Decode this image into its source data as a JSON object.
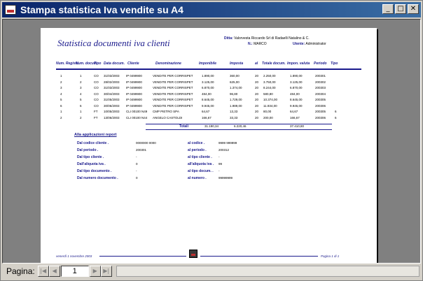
{
  "window": {
    "title": "Stampa statistica Iva vendite su A4",
    "minimize": "_",
    "maximize": "□",
    "close": "✕"
  },
  "report": {
    "title": "Statistica documenti iva clienti",
    "ditta_label": "Ditta:",
    "ditta_value": "Valorvesta Riccardo Srl di Radaelli Natalino & C.",
    "nr_label": "N.:",
    "nr_value": "MARCO",
    "utente_label": "Utente:",
    "utente_value": "Administrator",
    "columns": [
      "Num. Registr.",
      "Num. docum.",
      "Tipo",
      "Data docum.",
      "Cliente",
      "Denominazione",
      "Imponibile",
      "Imposta",
      "al",
      "Totale docum.",
      "Impon. valuta",
      "Periodo",
      "Tipo"
    ],
    "rows": [
      [
        "1",
        "1",
        "CO",
        "31/03/2003",
        "IP 0499900",
        "VENDITE PER CORRISPET",
        "1.890,00",
        "360,00",
        "20",
        "2.250,00",
        "1.890,00",
        "200301"
      ],
      [
        "2",
        "2",
        "CO",
        "28/02/2003",
        "IP 0499900",
        "VENDITE PER CORRISPET",
        "3.125,00",
        "625,00",
        "20",
        "3.750,00",
        "3.125,00",
        "200302"
      ],
      [
        "3",
        "3",
        "CO",
        "31/03/2003",
        "IP 0499900",
        "VENDITE PER CORRISPET",
        "6.870,00",
        "1.374,00",
        "20",
        "8.244,00",
        "6.870,00",
        "200303"
      ],
      [
        "4",
        "4",
        "CO",
        "30/04/2003",
        "IP 0499900",
        "VENDITE PER CORRISPET",
        "484,00",
        "96,80",
        "20",
        "580,80",
        "484,00",
        "200304"
      ],
      [
        "5",
        "5",
        "CO",
        "31/05/2003",
        "IP 0499900",
        "VENDITE PER CORRISPET",
        "8.645,00",
        "1.729,00",
        "20",
        "10.374,00",
        "8.645,00",
        "200305"
      ],
      [
        "6",
        "6",
        "CO",
        "30/06/2003",
        "IP 0499900",
        "VENDITE PER CORRISPET",
        "9.945,00",
        "1.989,00",
        "20",
        "11.934,00",
        "9.945,00",
        "200306"
      ],
      [
        "1",
        "1",
        "FT",
        "10/05/2003",
        "CLI 00100 N49",
        "CMP PIETRO SPA",
        "64,67",
        "13,33",
        "20",
        "80,00",
        "64,67",
        "200305"
      ],
      [
        "2",
        "2",
        "FT",
        "13/06/2003",
        "CLI 00100 N44",
        "ANGELO CASTOLDI",
        "166,67",
        "33,33",
        "20",
        "200,00",
        "166,67",
        "200306"
      ]
    ],
    "row_tipo_extra": [
      "",
      "",
      "",
      "",
      "",
      "",
      "6",
      "6"
    ],
    "total_label": "Totali",
    "totals": {
      "imponibile": "31.190,34",
      "imposta": "6.220,46",
      "totale": "37.410,80"
    },
    "filters_title": "Alla applicazioni report",
    "filters": [
      {
        "label": "Dal codice cliente .",
        "value": "0000000 0000",
        "label2": "al codice .",
        "value2": "9999 999999"
      },
      {
        "label": "Dal periodo .",
        "value": "200301",
        "label2": "al periodo .",
        "value2": "200312"
      },
      {
        "label": "Dal tipo cliente .",
        "value": "-",
        "label2": "al tipo cliente .",
        "value2": "-"
      },
      {
        "label": "Dall'aliquota iva .",
        "value": "0",
        "label2": "all'aliquota iva .",
        "value2": "99"
      },
      {
        "label": "Dal tipo documento .",
        "value": "-",
        "label2": "al tipo docum. .",
        "value2": "-"
      },
      {
        "label": "Dal numero documento .",
        "value": "0",
        "label2": "al numero .",
        "value2": "99999999"
      }
    ],
    "footer_left": "venerdì 1 novembre 2003",
    "footer_right": "Pagina 1 di 1"
  },
  "navigation": {
    "label": "Pagina:",
    "page": "1",
    "first": "|◀",
    "prev": "◀",
    "next": "▶",
    "last": "▶|"
  },
  "colors": {
    "accent": "#1a1a8c",
    "titlebar": "#0a246a"
  }
}
